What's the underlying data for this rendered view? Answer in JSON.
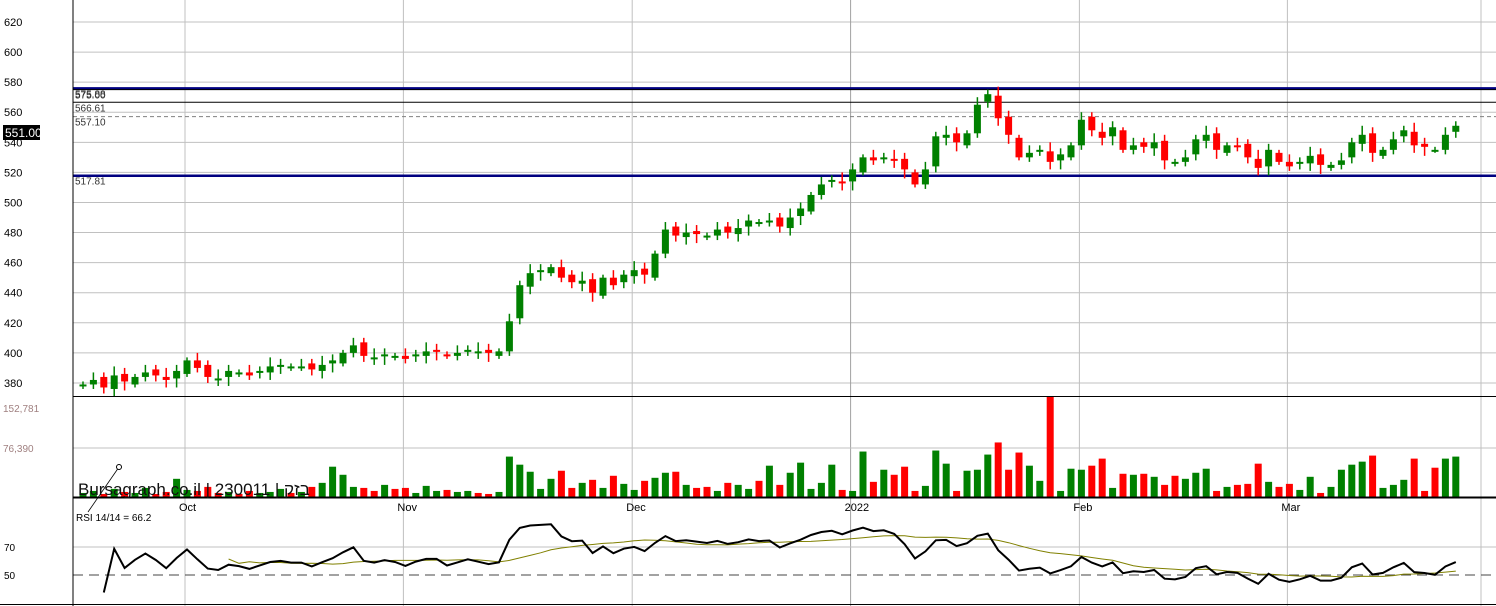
{
  "chart_data": {
    "type": "candlestick",
    "watermark": "Bursagraph.co.il | 230011 | בזק",
    "price_axis": {
      "ticks": [
        380,
        400,
        420,
        440,
        460,
        480,
        500,
        520,
        540,
        560,
        580,
        600,
        620
      ],
      "ylim": [
        375,
        632
      ]
    },
    "x_labels": [
      {
        "label": "Oct",
        "index": 10
      },
      {
        "label": "Nov",
        "index": 31
      },
      {
        "label": "Dec",
        "index": 53
      },
      {
        "label": "2022",
        "index": 74
      },
      {
        "label": "Feb",
        "index": 96
      },
      {
        "label": "Mar",
        "index": 116
      }
    ],
    "closes": [
      379,
      382,
      377,
      385,
      381,
      384,
      387,
      385,
      382,
      388,
      395,
      390,
      384,
      383,
      388,
      387,
      385,
      388,
      391,
      392,
      391,
      391,
      389,
      392,
      395,
      400,
      405,
      398,
      397,
      399,
      398,
      396,
      399,
      401,
      401,
      398,
      400,
      402,
      401,
      400,
      401,
      421,
      445,
      453,
      455,
      457,
      450,
      447,
      448,
      440,
      450,
      445,
      452,
      455,
      452,
      466,
      482,
      478,
      480,
      479,
      478,
      482,
      480,
      483,
      488,
      487,
      488,
      484,
      490,
      496,
      505,
      512,
      515,
      513,
      522,
      530,
      528,
      530,
      528,
      522,
      512,
      522,
      544,
      545,
      540,
      546,
      565,
      572,
      556,
      545,
      530,
      533,
      535,
      527,
      532,
      538,
      555,
      548,
      543,
      550,
      535,
      538,
      537,
      540,
      528,
      527,
      530,
      542,
      545,
      535,
      538,
      537,
      530,
      523,
      535,
      527,
      524,
      527,
      531,
      525,
      525,
      528,
      540,
      545,
      533,
      535,
      542,
      548,
      538,
      537,
      535,
      545,
      551
    ],
    "volumes": [
      4,
      6,
      3,
      8,
      5,
      4,
      9,
      3,
      5,
      18,
      7,
      6,
      10,
      4,
      5,
      3,
      6,
      4,
      5,
      8,
      4,
      5,
      10,
      14,
      30,
      22,
      10,
      9,
      6,
      12,
      8,
      9,
      4,
      11,
      6,
      7,
      5,
      6,
      4,
      3,
      5,
      40,
      32,
      25,
      8,
      18,
      26,
      9,
      14,
      17,
      9,
      21,
      13,
      7,
      16,
      19,
      24,
      25,
      12,
      9,
      10,
      6,
      14,
      12,
      8,
      16,
      31,
      12,
      24,
      34,
      8,
      14,
      32,
      7,
      6,
      45,
      15,
      27,
      22,
      30,
      6,
      11,
      46,
      33,
      6,
      26,
      27,
      42,
      54,
      27,
      44,
      31,
      16,
      99,
      6,
      28,
      27,
      31,
      38,
      9,
      23,
      22,
      23,
      20,
      12,
      21,
      18,
      24,
      28,
      6,
      10,
      12,
      13,
      33,
      15,
      10,
      13,
      7,
      20,
      4,
      10,
      27,
      32,
      35,
      41,
      9,
      12,
      17,
      38,
      6,
      29,
      38,
      40
    ],
    "volume_axis": {
      "ticks": [
        "152,781",
        "76,390"
      ]
    },
    "current_price": "551.00",
    "levels": [
      {
        "value": 575.88,
        "label": "575.88",
        "style": "solid-navy"
      },
      {
        "value": 575.0,
        "label": "575.00",
        "style": "solid"
      },
      {
        "value": 566.61,
        "label": "566.61",
        "style": "solid"
      },
      {
        "value": 557.1,
        "label": "557.10",
        "style": "dashed"
      },
      {
        "value": 517.81,
        "label": "517.81",
        "style": "solid-navy"
      }
    ],
    "rsi": {
      "label": "RSI 14/14 = 66.2",
      "period": 14,
      "signal_period": 14,
      "ticks": [
        "70",
        "50"
      ],
      "reference": 50
    },
    "colors": {
      "up": "#008000",
      "down": "#ff0000",
      "levels": "#000080",
      "rsi": "#000000",
      "rsi_signal": "#808000",
      "grid": "#c0c0c0"
    }
  }
}
